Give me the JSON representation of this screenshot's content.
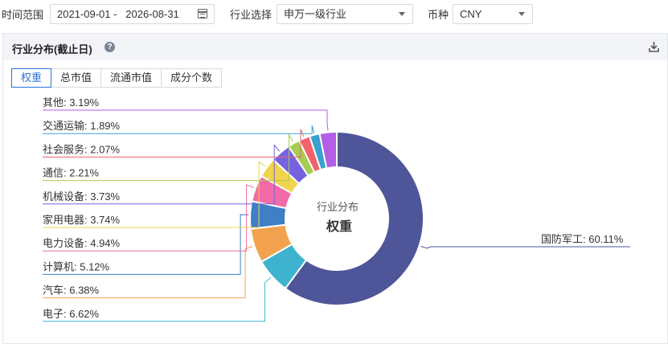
{
  "filters": {
    "time_label": "时间范围",
    "date_range": "2021-09-01 -   2026-08-31",
    "industry_label": "行业选择",
    "industry_value": "申万一级行业",
    "currency_label": "币种",
    "currency_value": "CNY"
  },
  "panel": {
    "title": "行业分布(截止日)",
    "help": "?",
    "tabs": [
      "权重",
      "总市值",
      "流通市值",
      "成分个数"
    ],
    "active_tab": 0
  },
  "chart_data": {
    "type": "pie",
    "donut": true,
    "center_label": "行业分布",
    "center_value": "权重",
    "unit": "%",
    "slices": [
      {
        "name": "国防军工",
        "value": 60.11,
        "label": "国防军工: 60.11%",
        "color": "#4e5699"
      },
      {
        "name": "电子",
        "value": 6.62,
        "label": "电子: 6.62%",
        "color": "#3db3cf"
      },
      {
        "name": "汽车",
        "value": 6.38,
        "label": "汽车: 6.38%",
        "color": "#f2a24f"
      },
      {
        "name": "计算机",
        "value": 5.12,
        "label": "计算机: 5.12%",
        "color": "#3f7fc6"
      },
      {
        "name": "电力设备",
        "value": 4.94,
        "label": "电力设备: 4.94%",
        "color": "#f26aa6"
      },
      {
        "name": "家用电器",
        "value": 3.74,
        "label": "家用电器: 3.74%",
        "color": "#f2d34c"
      },
      {
        "name": "机械设备",
        "value": 3.73,
        "label": "机械设备: 3.73%",
        "color": "#7562e0"
      },
      {
        "name": "通信",
        "value": 2.21,
        "label": "通信: 2.21%",
        "color": "#a6cc52"
      },
      {
        "name": "社会服务",
        "value": 2.07,
        "label": "社会服务: 2.07%",
        "color": "#f0636b"
      },
      {
        "name": "交通运输",
        "value": 1.89,
        "label": "交通运输: 1.89%",
        "color": "#3aa1cf"
      },
      {
        "name": "其他",
        "value": 3.19,
        "label": "其他: 3.19%",
        "color": "#b45ee6"
      }
    ]
  }
}
